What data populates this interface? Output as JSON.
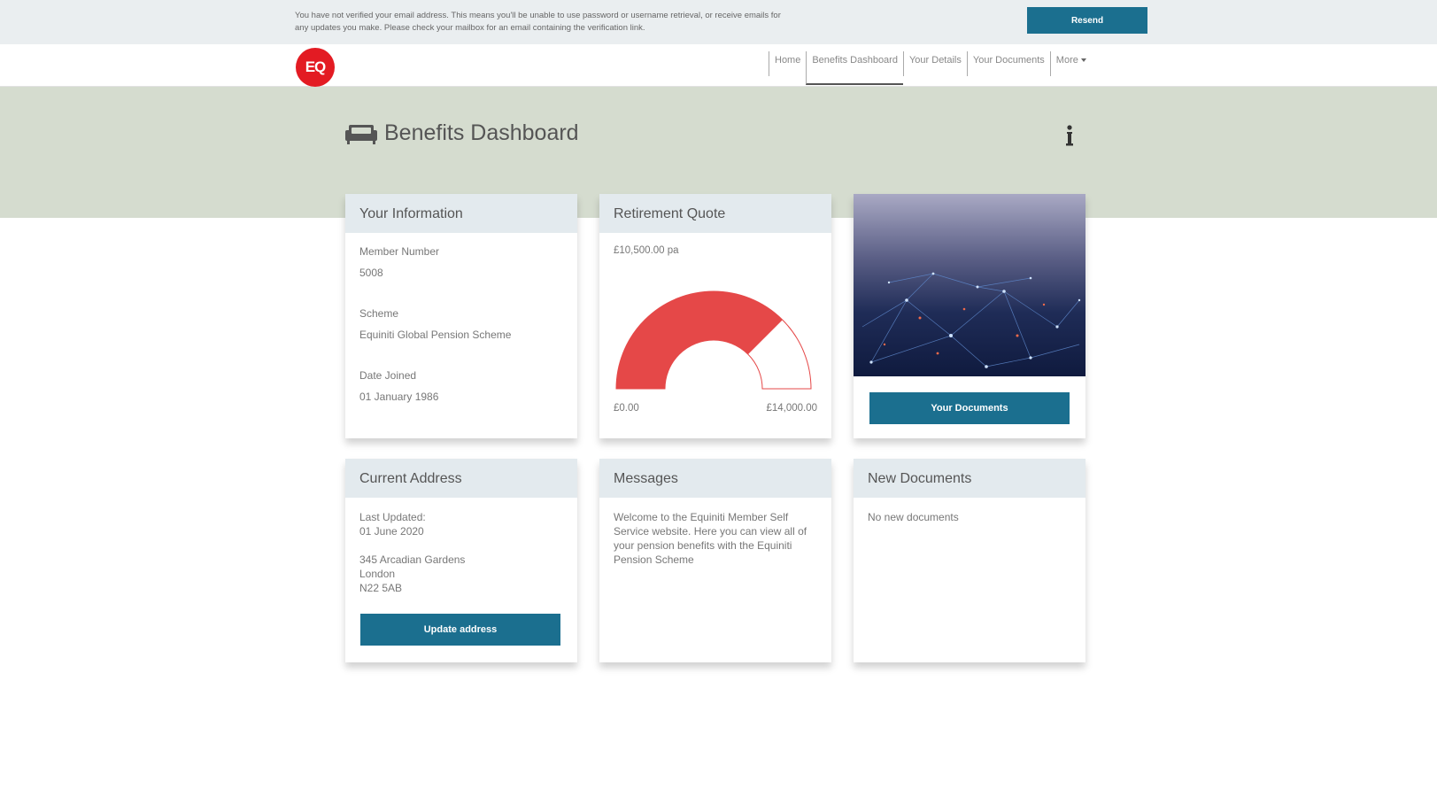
{
  "notice": {
    "text": "You have not verified your email address. This means you'll be unable to use password or username retrieval, or receive emails for any updates you make. Please check your mailbox for an email containing the verification link.",
    "resend_label": "Resend"
  },
  "header": {
    "logo_text": "EQ",
    "nav": [
      {
        "label": "Home"
      },
      {
        "label": "Benefits Dashboard"
      },
      {
        "label": "Your Details"
      },
      {
        "label": "Your Documents"
      },
      {
        "label": "More"
      }
    ],
    "active_nav": "Benefits Dashboard"
  },
  "page": {
    "title": "Benefits Dashboard"
  },
  "your_information": {
    "title": "Your Information",
    "member_number_label": "Member Number",
    "member_number": "5008",
    "scheme_label": "Scheme",
    "scheme": "Equiniti Global Pension Scheme",
    "date_joined_label": "Date Joined",
    "date_joined": "01 January 1986"
  },
  "retirement_quote": {
    "title": "Retirement Quote",
    "amount": "£10,500.00 pa",
    "min_label": "£0.00",
    "max_label": "£14,000.00",
    "value": 10500,
    "max": 14000,
    "colors": {
      "fill": "#e54848",
      "outline": "#e54848"
    }
  },
  "image_card": {
    "button_label": "Your Documents"
  },
  "current_address": {
    "title": "Current Address",
    "last_updated_label": "Last Updated:",
    "last_updated": "01 June 2020",
    "line1": "345 Arcadian Gardens",
    "line2": "London",
    "line3": "N22 5AB",
    "button_label": "Update address"
  },
  "messages": {
    "title": "Messages",
    "text": "Welcome to the Equiniti Member Self Service website. Here you can view all of your pension benefits with the Equiniti Pension Scheme"
  },
  "new_documents": {
    "title": "New Documents",
    "empty_text": "No new documents"
  },
  "theme": {
    "accent": "#1b6f8f",
    "brand_red": "#e31b23",
    "hero_bg": "#d5dccf",
    "card_header_bg": "#e3eaee"
  }
}
